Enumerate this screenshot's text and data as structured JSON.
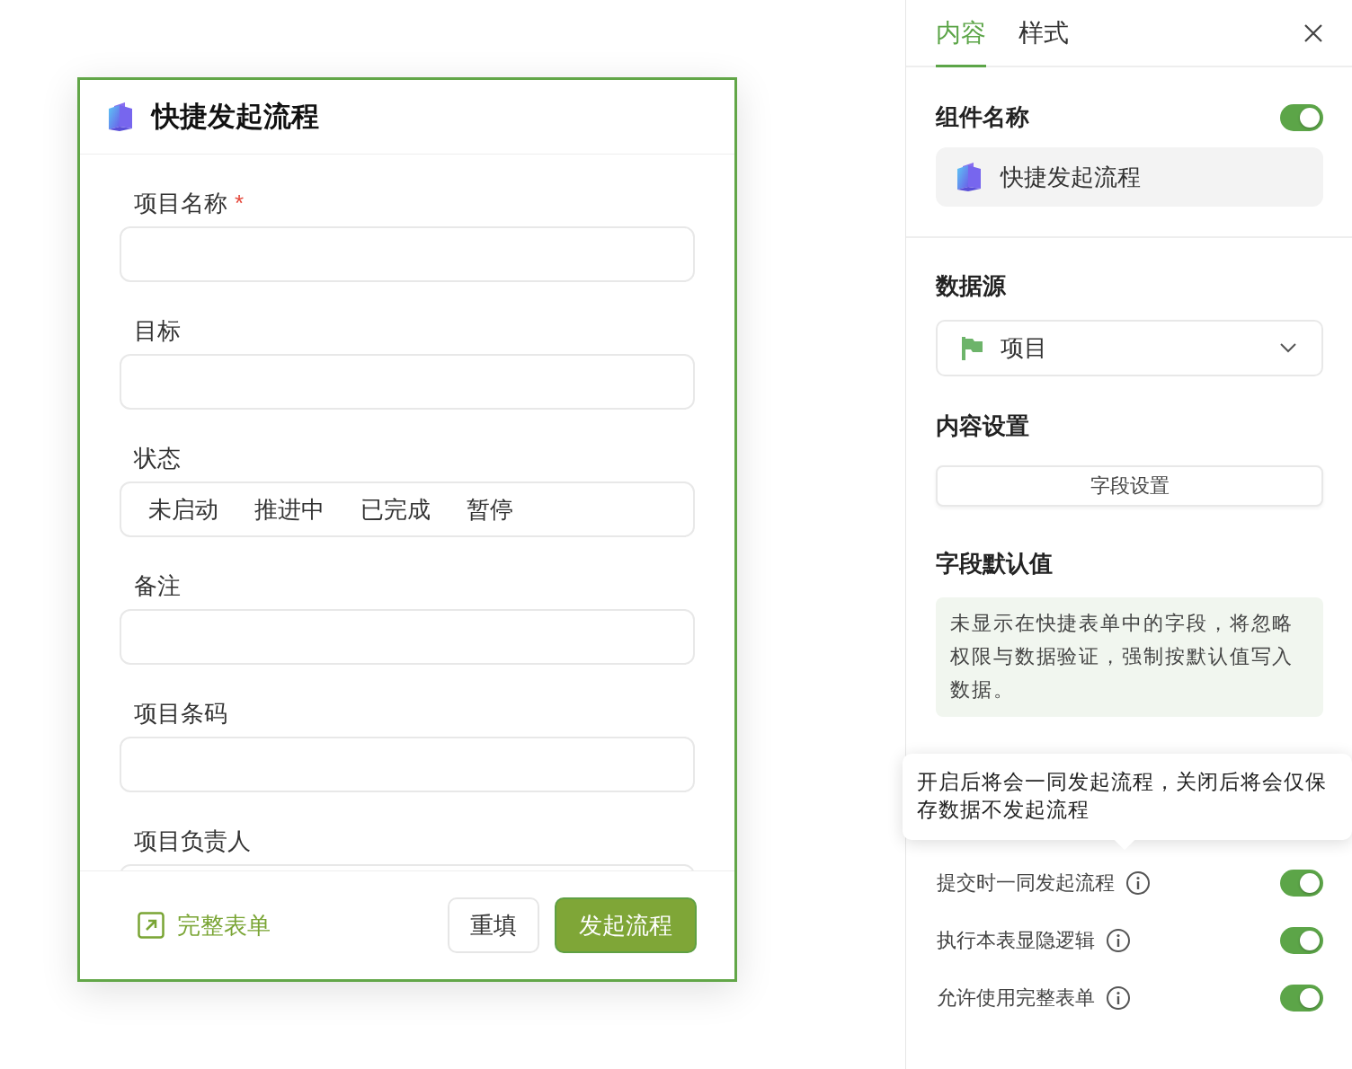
{
  "form": {
    "title": "快捷发起流程",
    "required_mark": "*",
    "fields": [
      {
        "label": "项目名称",
        "required": true,
        "kind": "text"
      },
      {
        "label": "目标",
        "required": false,
        "kind": "text"
      },
      {
        "label": "状态",
        "required": false,
        "kind": "options",
        "options": [
          "未启动",
          "推进中",
          "已完成",
          "暂停"
        ]
      },
      {
        "label": "备注",
        "required": false,
        "kind": "text"
      },
      {
        "label": "项目条码",
        "required": false,
        "kind": "text"
      },
      {
        "label": "项目负责人",
        "required": false,
        "kind": "text"
      }
    ],
    "full_form_link": "完整表单",
    "reset_button": "重填",
    "submit_button": "发起流程"
  },
  "panel": {
    "tabs": [
      {
        "label": "内容",
        "selected": true
      },
      {
        "label": "样式",
        "selected": false
      }
    ],
    "component_name": {
      "label": "组件名称",
      "on": true,
      "value": "快捷发起流程"
    },
    "data_source": {
      "label": "数据源",
      "value": "项目"
    },
    "content_settings": {
      "label": "内容设置",
      "button": "字段设置"
    },
    "field_defaults": {
      "label": "字段默认值",
      "note": "未显示在快捷表单中的字段，将忽略权限与数据验证，强制按默认值写入数据。"
    },
    "tooltip": "开启后将会一同发起流程，关闭后将会仅保存数据不发起流程",
    "switches": [
      {
        "label": "提交时一同发起流程",
        "on": true
      },
      {
        "label": "执行本表显隐逻辑",
        "on": true
      },
      {
        "label": "允许使用完整表单",
        "on": true
      }
    ]
  }
}
